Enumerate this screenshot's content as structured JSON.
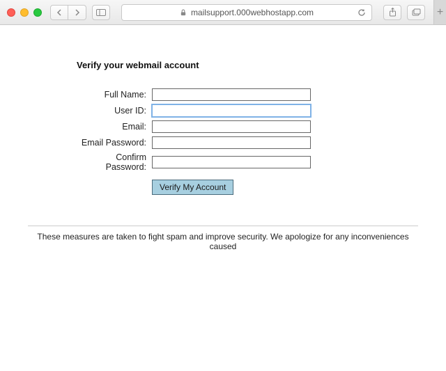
{
  "browser": {
    "url": "mailsupport.000webhostapp.com"
  },
  "page": {
    "title": "Verify your webmail account",
    "fields": {
      "full_name": {
        "label": "Full Name:",
        "value": ""
      },
      "user_id": {
        "label": "User ID:",
        "value": ""
      },
      "email": {
        "label": "Email:",
        "value": ""
      },
      "email_password": {
        "label": "Email Password:",
        "value": ""
      },
      "confirm_password": {
        "label": "Confirm Password:",
        "value": ""
      }
    },
    "submit_label": "Verify My Account",
    "footer": "These measures are taken to fight spam and improve security. We apologize for any inconveniences caused"
  }
}
